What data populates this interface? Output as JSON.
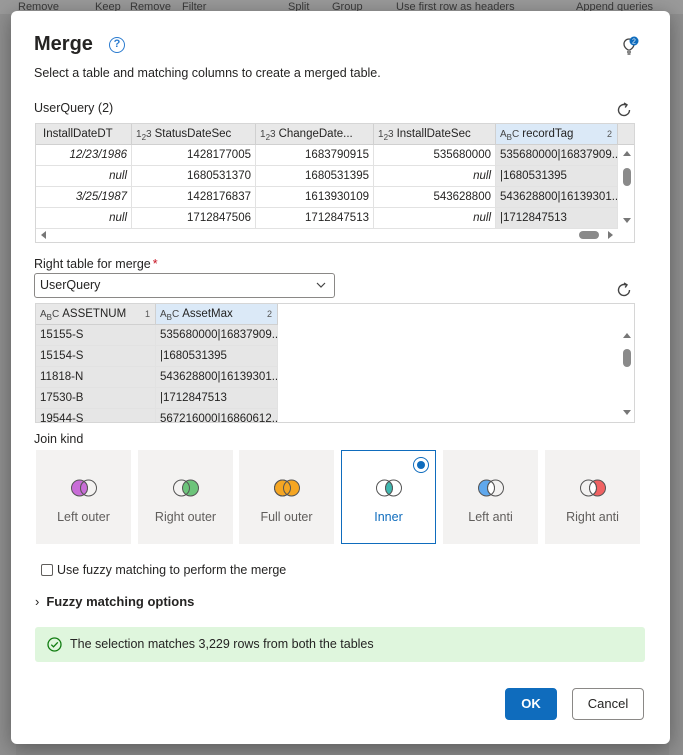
{
  "background": {
    "ribbon": [
      "Remove",
      "Keep",
      "Remove",
      "Filter",
      "Split",
      "Group",
      "Use first row as headers",
      "Append queries"
    ]
  },
  "dialog": {
    "title": "Merge",
    "subtitle": "Select a table and matching columns to create a merged table.",
    "bulb_badge": "2"
  },
  "left_table": {
    "label": "UserQuery (2)",
    "columns": [
      {
        "type": "",
        "name": "InstallDateDT",
        "num": ""
      },
      {
        "type": "123",
        "name": "StatusDateSec",
        "num": ""
      },
      {
        "type": "123",
        "name": "ChangeDate...",
        "num": ""
      },
      {
        "type": "123",
        "name": "InstallDateSec",
        "num": ""
      },
      {
        "type": "ABC",
        "name": "recordTag",
        "num": "2"
      }
    ],
    "rows": [
      [
        "12/23/1986",
        "1428177005",
        "1683790915",
        "535680000",
        "535680000|16837909..."
      ],
      [
        "null",
        "1680531370",
        "1680531395",
        "null",
        "|1680531395"
      ],
      [
        "3/25/1987",
        "1428176837",
        "1613930109",
        "543628800",
        "543628800|16139301..."
      ],
      [
        "null",
        "1712847506",
        "1712847513",
        "null",
        "|1712847513"
      ]
    ]
  },
  "right_table": {
    "label": "Right table for merge",
    "required_mark": "*",
    "selected": "UserQuery",
    "columns": [
      {
        "type": "ABC",
        "name": "ASSETNUM",
        "num": "1"
      },
      {
        "type": "ABC",
        "name": "AssetMax",
        "num": "2"
      }
    ],
    "rows": [
      [
        "15155-S",
        "535680000|16837909..."
      ],
      [
        "15154-S",
        "|1680531395"
      ],
      [
        "11818-N",
        "543628800|16139301..."
      ],
      [
        "17530-B",
        "|1712847513"
      ],
      [
        "19544-S",
        "567216000|16860612..."
      ]
    ]
  },
  "join_kind": {
    "label": "Join kind",
    "options": [
      {
        "label": "Left outer",
        "selected": false,
        "colors": [
          "#c86dd7",
          "#ffffff"
        ]
      },
      {
        "label": "Right outer",
        "selected": false,
        "colors": [
          "#ffffff",
          "#6cc47a"
        ]
      },
      {
        "label": "Full outer",
        "selected": false,
        "colors": [
          "#f5a623",
          "#f5a623"
        ]
      },
      {
        "label": "Inner",
        "selected": true,
        "colors": [
          "#ffffff",
          "#ffffff"
        ]
      },
      {
        "label": "Left anti",
        "selected": false,
        "colors": [
          "#5fa8ed",
          "#ffffff"
        ]
      },
      {
        "label": "Right anti",
        "selected": false,
        "colors": [
          "#ffffff",
          "#f06262"
        ]
      }
    ]
  },
  "fuzzy": {
    "checkbox_label": "Use fuzzy matching to perform the merge",
    "options_label": "Fuzzy matching options"
  },
  "status": {
    "message": "The selection matches 3,229 rows from both the tables"
  },
  "buttons": {
    "ok": "OK",
    "cancel": "Cancel"
  }
}
